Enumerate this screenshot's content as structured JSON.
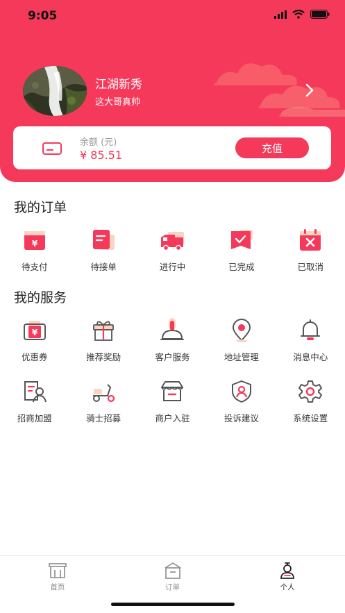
{
  "status_bar": {
    "time": "9:05"
  },
  "profile": {
    "name": "江湖新秀",
    "signature": "这大哥真帅"
  },
  "balance": {
    "label": "余额 (元)",
    "value": "¥ 85.51",
    "recharge_label": "充值"
  },
  "orders": {
    "title": "我的订单",
    "items": [
      {
        "label": "待支付",
        "icon": "pending-payment-icon"
      },
      {
        "label": "待接单",
        "icon": "pending-accept-icon"
      },
      {
        "label": "进行中",
        "icon": "delivery-truck-icon"
      },
      {
        "label": "已完成",
        "icon": "completed-icon"
      },
      {
        "label": "已取消",
        "icon": "cancelled-icon"
      }
    ]
  },
  "services": {
    "title": "我的服务",
    "row1": [
      {
        "label": "优惠券",
        "icon": "coupon-icon"
      },
      {
        "label": "推荐奖励",
        "icon": "gift-icon"
      },
      {
        "label": "客户服务",
        "icon": "customer-service-icon"
      },
      {
        "label": "地址管理",
        "icon": "location-icon"
      },
      {
        "label": "消息中心",
        "icon": "bell-icon"
      }
    ],
    "row2": [
      {
        "label": "招商加盟",
        "icon": "franchise-icon"
      },
      {
        "label": "骑士招募",
        "icon": "scooter-icon"
      },
      {
        "label": "商户入驻",
        "icon": "shop-icon"
      },
      {
        "label": "投诉建议",
        "icon": "shield-user-icon"
      },
      {
        "label": "系统设置",
        "icon": "gear-icon"
      }
    ]
  },
  "tabbar": {
    "home": "首页",
    "orders": "订单",
    "me": "个人",
    "active": "me"
  },
  "colors": {
    "brand": "#f5395a",
    "accent_light": "#fbd3c4"
  }
}
